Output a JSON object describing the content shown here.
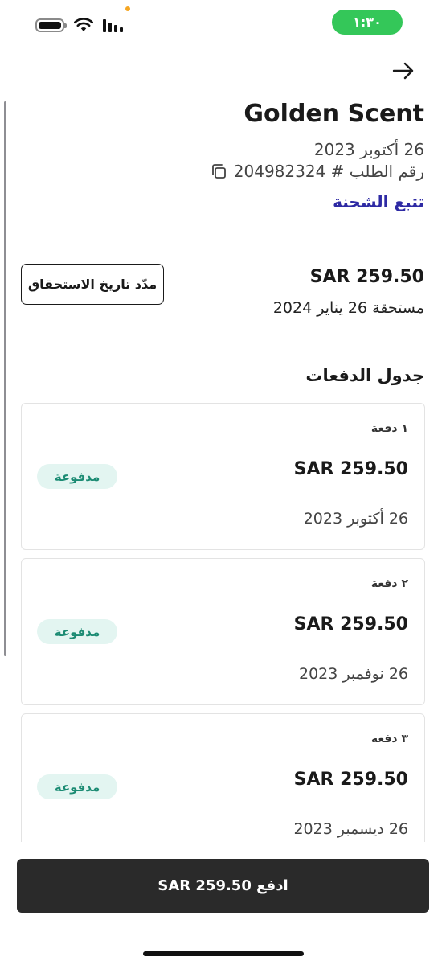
{
  "status_bar": {
    "time": "١:٣٠"
  },
  "header": {
    "title": "Golden Scent"
  },
  "order": {
    "date": "26 أكتوبر 2023",
    "number_line": "رقم الطلب # 204982324",
    "track_label": "تتبع الشحنة"
  },
  "due": {
    "amount": "SAR 259.50",
    "due_text": "مستحقة 26 يناير 2024",
    "extend_label": "مدّد تاريخ الاستحقاق"
  },
  "schedule": {
    "title": "جدول الدفعات",
    "items": [
      {
        "label": "١ دفعة",
        "amount": "SAR 259.50",
        "status": "مدفوعة",
        "date": "26 أكتوبر 2023"
      },
      {
        "label": "٢ دفعة",
        "amount": "SAR 259.50",
        "status": "مدفوعة",
        "date": "26 نوفمبر 2023"
      },
      {
        "label": "٣ دفعة",
        "amount": "SAR 259.50",
        "status": "مدفوعة",
        "date": "26 ديسمبر 2023"
      }
    ]
  },
  "footer": {
    "pay_label": "ادفع SAR 259.50"
  },
  "colors": {
    "accent_link": "#2e2aa4",
    "paid_badge_bg": "#e3f5f1",
    "paid_badge_text": "#1b8b73",
    "time_pill": "#34c759"
  }
}
